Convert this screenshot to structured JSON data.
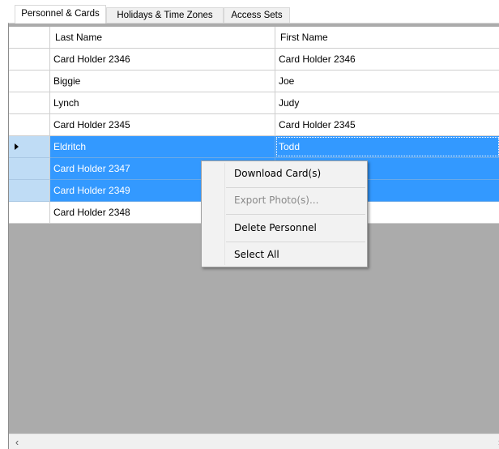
{
  "tabs": [
    {
      "label": "Personnel & Cards",
      "active": true
    },
    {
      "label": "Holidays & Time Zones",
      "active": false
    },
    {
      "label": "Access Sets",
      "active": false
    }
  ],
  "grid": {
    "columns": [
      "Last Name",
      "First Name"
    ],
    "rows": [
      {
        "last": "Card Holder 2346",
        "first": "Card Holder 2346",
        "selected": false
      },
      {
        "last": "Biggie",
        "first": "Joe",
        "selected": false
      },
      {
        "last": "Lynch",
        "first": "Judy",
        "selected": false
      },
      {
        "last": "Card Holder 2345",
        "first": "Card Holder 2345",
        "selected": false
      },
      {
        "last": "Eldritch",
        "first": "Todd",
        "selected": true,
        "current": true
      },
      {
        "last": "Card Holder 2347",
        "first": "",
        "selected": true
      },
      {
        "last": "Card Holder 2349",
        "first": "",
        "selected": true
      },
      {
        "last": "Card Holder 2348",
        "first": "",
        "selected": false
      }
    ]
  },
  "context_menu": {
    "items": [
      {
        "label": "Download Card(s)",
        "enabled": true
      },
      {
        "label": "Export Photo(s)...",
        "enabled": false
      },
      {
        "label": "Delete Personnel",
        "enabled": true
      },
      {
        "label": "Select All",
        "enabled": true
      }
    ]
  },
  "scrollbar": {
    "left_icon": "chevron-left-icon",
    "right_icon": "chevron-right-icon"
  },
  "colors": {
    "selection": "#3399ff",
    "empty_area": "#ababab",
    "menu_bg": "#f2f2f2"
  }
}
